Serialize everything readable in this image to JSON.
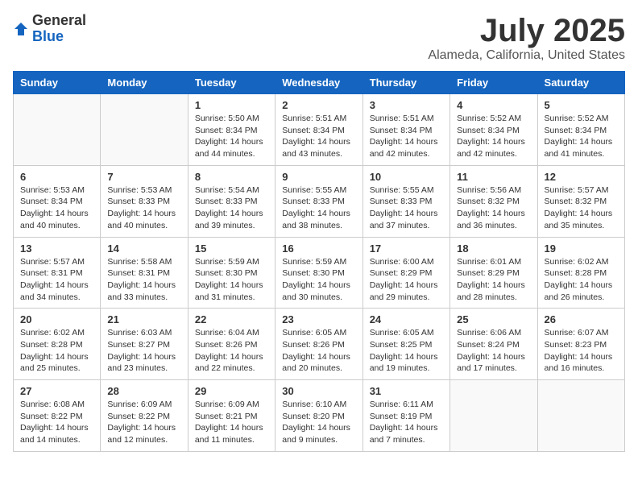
{
  "logo": {
    "general": "General",
    "blue": "Blue"
  },
  "title": "July 2025",
  "subtitle": "Alameda, California, United States",
  "weekdays": [
    "Sunday",
    "Monday",
    "Tuesday",
    "Wednesday",
    "Thursday",
    "Friday",
    "Saturday"
  ],
  "weeks": [
    [
      {
        "day": "",
        "sunrise": "",
        "sunset": "",
        "daylight": ""
      },
      {
        "day": "",
        "sunrise": "",
        "sunset": "",
        "daylight": ""
      },
      {
        "day": "1",
        "sunrise": "Sunrise: 5:50 AM",
        "sunset": "Sunset: 8:34 PM",
        "daylight": "Daylight: 14 hours and 44 minutes."
      },
      {
        "day": "2",
        "sunrise": "Sunrise: 5:51 AM",
        "sunset": "Sunset: 8:34 PM",
        "daylight": "Daylight: 14 hours and 43 minutes."
      },
      {
        "day": "3",
        "sunrise": "Sunrise: 5:51 AM",
        "sunset": "Sunset: 8:34 PM",
        "daylight": "Daylight: 14 hours and 42 minutes."
      },
      {
        "day": "4",
        "sunrise": "Sunrise: 5:52 AM",
        "sunset": "Sunset: 8:34 PM",
        "daylight": "Daylight: 14 hours and 42 minutes."
      },
      {
        "day": "5",
        "sunrise": "Sunrise: 5:52 AM",
        "sunset": "Sunset: 8:34 PM",
        "daylight": "Daylight: 14 hours and 41 minutes."
      }
    ],
    [
      {
        "day": "6",
        "sunrise": "Sunrise: 5:53 AM",
        "sunset": "Sunset: 8:34 PM",
        "daylight": "Daylight: 14 hours and 40 minutes."
      },
      {
        "day": "7",
        "sunrise": "Sunrise: 5:53 AM",
        "sunset": "Sunset: 8:33 PM",
        "daylight": "Daylight: 14 hours and 40 minutes."
      },
      {
        "day": "8",
        "sunrise": "Sunrise: 5:54 AM",
        "sunset": "Sunset: 8:33 PM",
        "daylight": "Daylight: 14 hours and 39 minutes."
      },
      {
        "day": "9",
        "sunrise": "Sunrise: 5:55 AM",
        "sunset": "Sunset: 8:33 PM",
        "daylight": "Daylight: 14 hours and 38 minutes."
      },
      {
        "day": "10",
        "sunrise": "Sunrise: 5:55 AM",
        "sunset": "Sunset: 8:33 PM",
        "daylight": "Daylight: 14 hours and 37 minutes."
      },
      {
        "day": "11",
        "sunrise": "Sunrise: 5:56 AM",
        "sunset": "Sunset: 8:32 PM",
        "daylight": "Daylight: 14 hours and 36 minutes."
      },
      {
        "day": "12",
        "sunrise": "Sunrise: 5:57 AM",
        "sunset": "Sunset: 8:32 PM",
        "daylight": "Daylight: 14 hours and 35 minutes."
      }
    ],
    [
      {
        "day": "13",
        "sunrise": "Sunrise: 5:57 AM",
        "sunset": "Sunset: 8:31 PM",
        "daylight": "Daylight: 14 hours and 34 minutes."
      },
      {
        "day": "14",
        "sunrise": "Sunrise: 5:58 AM",
        "sunset": "Sunset: 8:31 PM",
        "daylight": "Daylight: 14 hours and 33 minutes."
      },
      {
        "day": "15",
        "sunrise": "Sunrise: 5:59 AM",
        "sunset": "Sunset: 8:30 PM",
        "daylight": "Daylight: 14 hours and 31 minutes."
      },
      {
        "day": "16",
        "sunrise": "Sunrise: 5:59 AM",
        "sunset": "Sunset: 8:30 PM",
        "daylight": "Daylight: 14 hours and 30 minutes."
      },
      {
        "day": "17",
        "sunrise": "Sunrise: 6:00 AM",
        "sunset": "Sunset: 8:29 PM",
        "daylight": "Daylight: 14 hours and 29 minutes."
      },
      {
        "day": "18",
        "sunrise": "Sunrise: 6:01 AM",
        "sunset": "Sunset: 8:29 PM",
        "daylight": "Daylight: 14 hours and 28 minutes."
      },
      {
        "day": "19",
        "sunrise": "Sunrise: 6:02 AM",
        "sunset": "Sunset: 8:28 PM",
        "daylight": "Daylight: 14 hours and 26 minutes."
      }
    ],
    [
      {
        "day": "20",
        "sunrise": "Sunrise: 6:02 AM",
        "sunset": "Sunset: 8:28 PM",
        "daylight": "Daylight: 14 hours and 25 minutes."
      },
      {
        "day": "21",
        "sunrise": "Sunrise: 6:03 AM",
        "sunset": "Sunset: 8:27 PM",
        "daylight": "Daylight: 14 hours and 23 minutes."
      },
      {
        "day": "22",
        "sunrise": "Sunrise: 6:04 AM",
        "sunset": "Sunset: 8:26 PM",
        "daylight": "Daylight: 14 hours and 22 minutes."
      },
      {
        "day": "23",
        "sunrise": "Sunrise: 6:05 AM",
        "sunset": "Sunset: 8:26 PM",
        "daylight": "Daylight: 14 hours and 20 minutes."
      },
      {
        "day": "24",
        "sunrise": "Sunrise: 6:05 AM",
        "sunset": "Sunset: 8:25 PM",
        "daylight": "Daylight: 14 hours and 19 minutes."
      },
      {
        "day": "25",
        "sunrise": "Sunrise: 6:06 AM",
        "sunset": "Sunset: 8:24 PM",
        "daylight": "Daylight: 14 hours and 17 minutes."
      },
      {
        "day": "26",
        "sunrise": "Sunrise: 6:07 AM",
        "sunset": "Sunset: 8:23 PM",
        "daylight": "Daylight: 14 hours and 16 minutes."
      }
    ],
    [
      {
        "day": "27",
        "sunrise": "Sunrise: 6:08 AM",
        "sunset": "Sunset: 8:22 PM",
        "daylight": "Daylight: 14 hours and 14 minutes."
      },
      {
        "day": "28",
        "sunrise": "Sunrise: 6:09 AM",
        "sunset": "Sunset: 8:22 PM",
        "daylight": "Daylight: 14 hours and 12 minutes."
      },
      {
        "day": "29",
        "sunrise": "Sunrise: 6:09 AM",
        "sunset": "Sunset: 8:21 PM",
        "daylight": "Daylight: 14 hours and 11 minutes."
      },
      {
        "day": "30",
        "sunrise": "Sunrise: 6:10 AM",
        "sunset": "Sunset: 8:20 PM",
        "daylight": "Daylight: 14 hours and 9 minutes."
      },
      {
        "day": "31",
        "sunrise": "Sunrise: 6:11 AM",
        "sunset": "Sunset: 8:19 PM",
        "daylight": "Daylight: 14 hours and 7 minutes."
      },
      {
        "day": "",
        "sunrise": "",
        "sunset": "",
        "daylight": ""
      },
      {
        "day": "",
        "sunrise": "",
        "sunset": "",
        "daylight": ""
      }
    ]
  ]
}
